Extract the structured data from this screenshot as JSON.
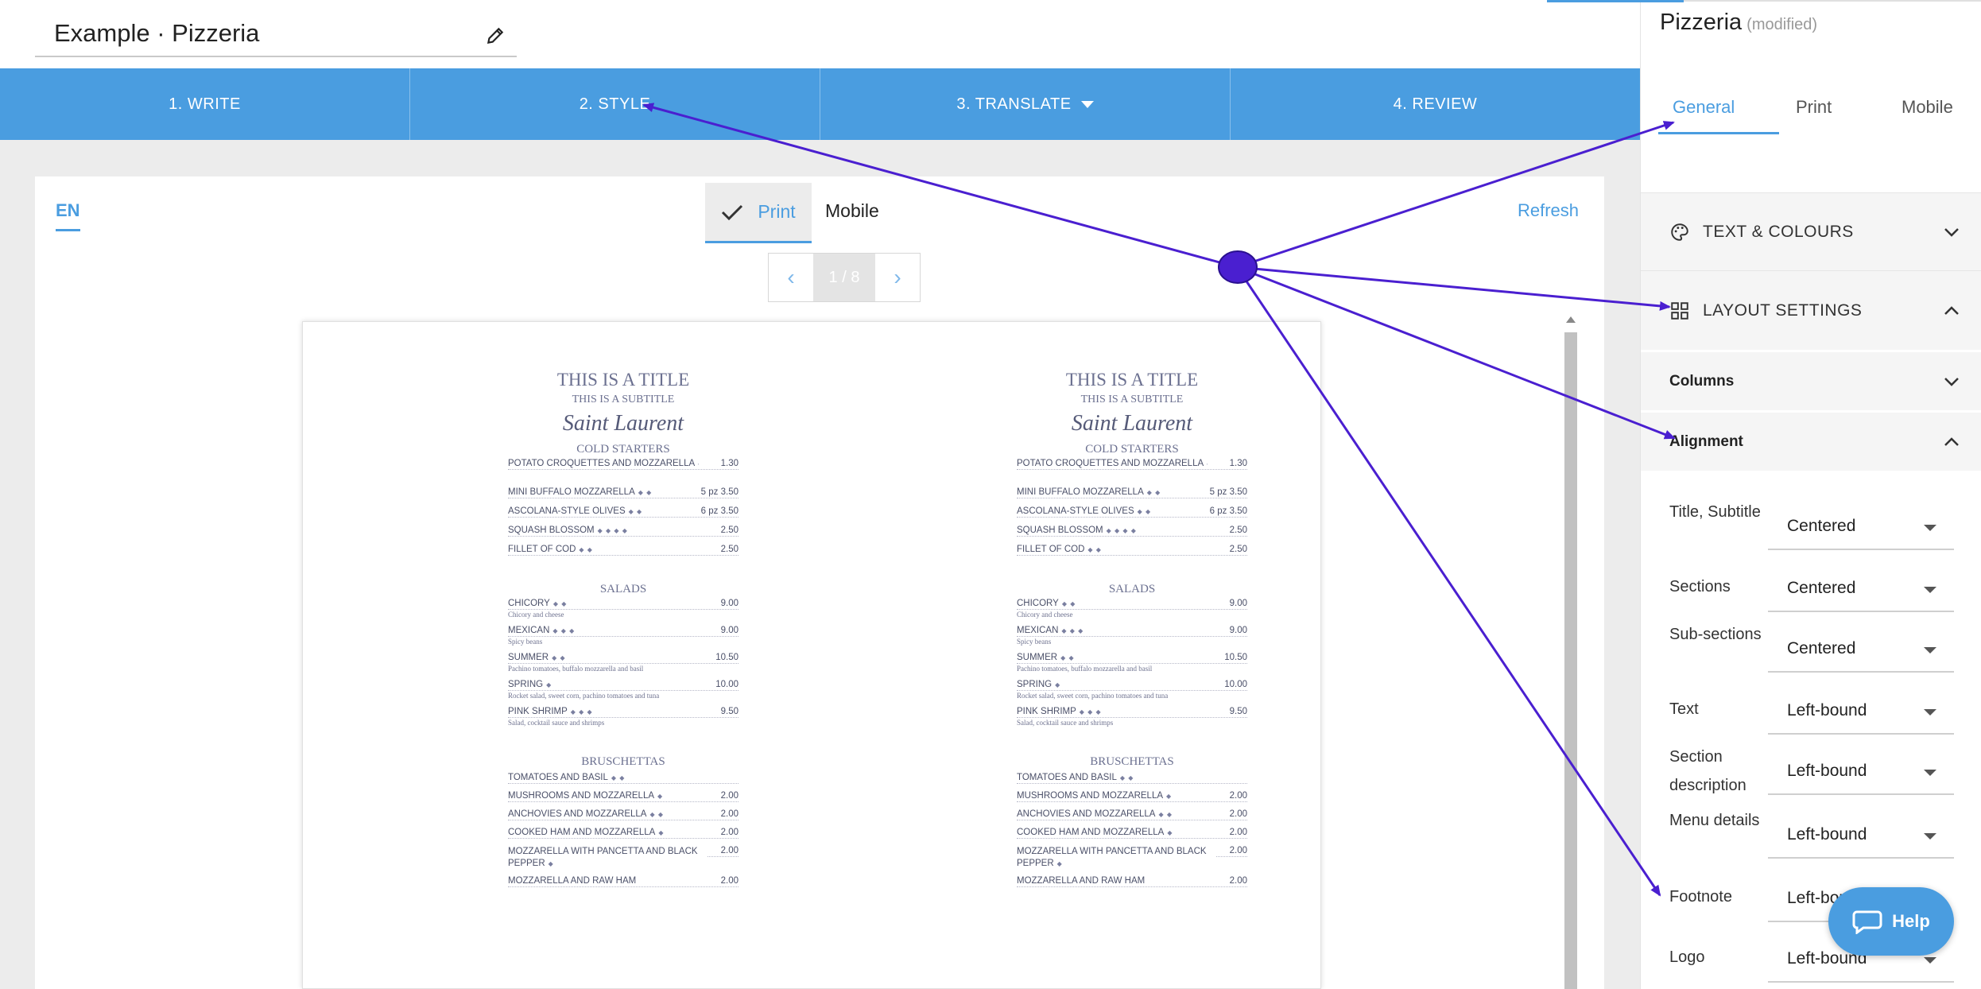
{
  "document": {
    "title": "Example · Pizzeria"
  },
  "steps": [
    {
      "label": "1. WRITE"
    },
    {
      "label": "2. STYLE"
    },
    {
      "label": "3. TRANSLATE"
    },
    {
      "label": "4. REVIEW"
    }
  ],
  "preview": {
    "language": "EN",
    "print_label": "Print",
    "mobile_label": "Mobile",
    "refresh_label": "Refresh",
    "pager": {
      "current": "1 / 8"
    }
  },
  "menu": {
    "title": "THIS IS A TITLE",
    "subtitle": "THIS IS A SUBTITLE",
    "script": "Saint Laurent",
    "sections": [
      {
        "name": "COLD STARTERS",
        "items": [
          {
            "name": "POTATO CROQUETTES AND MOZZARELLA",
            "price": "1.30",
            "icons": "◆ ◆ ▴"
          },
          {
            "name": "MINI BUFFALO MOZZARELLA",
            "price": "5 pz 3.50",
            "icons": "◆ ◆"
          },
          {
            "name": "ASCOLANA-STYLE OLIVES",
            "price": "6 pz 3.50",
            "icons": "◆ ◆"
          },
          {
            "name": "SQUASH BLOSSOM",
            "price": "2.50",
            "icons": "◆ ◆ ◆ ◆"
          },
          {
            "name": "FILLET OF COD",
            "price": "2.50",
            "icons": "◆ ◆"
          }
        ]
      },
      {
        "name": "SALADS",
        "items": [
          {
            "name": "CHICORY",
            "price": "9.00",
            "desc": "Chicory and cheese",
            "icons": "◆ ◆"
          },
          {
            "name": "MEXICAN",
            "price": "9.00",
            "desc": "Spicy beans",
            "icons": "◆ ◆ ◆"
          },
          {
            "name": "SUMMER",
            "price": "10.50",
            "desc": "Pachino tomatoes, buffalo mozzarella and basil",
            "icons": "◆ ◆"
          },
          {
            "name": "SPRING",
            "price": "10.00",
            "desc": "Rocket salad, sweet corn, pachino tomatoes and tuna",
            "icons": "◆"
          },
          {
            "name": "PINK SHRIMP",
            "price": "9.50",
            "desc": "Salad, cocktail sauce and shrimps",
            "icons": "◆ ◆ ◆"
          }
        ]
      },
      {
        "name": "BRUSCHETTAS",
        "items": [
          {
            "name": "TOMATOES AND BASIL",
            "price": "",
            "icons": "◆ ◆"
          },
          {
            "name": "MUSHROOMS AND MOZZARELLA",
            "price": "2.00",
            "icons": "◆"
          },
          {
            "name": "ANCHOVIES AND MOZZARELLA",
            "price": "2.00",
            "icons": "◆ ◆"
          },
          {
            "name": "COOKED HAM AND MOZZARELLA",
            "price": "2.00",
            "icons": "◆"
          },
          {
            "name": "MOZZARELLA WITH PANCETTA AND BLACK PEPPER",
            "price": "2.00",
            "icons": "◆"
          },
          {
            "name": "MOZZARELLA AND RAW HAM",
            "price": "2.00",
            "icons": ""
          }
        ]
      }
    ]
  },
  "panel": {
    "title": "Pizzeria",
    "status": "(modified)",
    "tabs": [
      "General",
      "Print",
      "Mobile"
    ],
    "sections": {
      "text_colours": "TEXT & COLOURS",
      "layout_settings": "LAYOUT SETTINGS",
      "columns": "Columns",
      "alignment": "Alignment"
    },
    "alignment_rows": [
      {
        "label": "Title, Subtitle",
        "value": "Centered"
      },
      {
        "label": "Sections",
        "value": "Centered"
      },
      {
        "label": "Sub-sections",
        "value": "Centered"
      },
      {
        "label": "Text",
        "value": "Left-bound"
      },
      {
        "label": "Section description",
        "value": "Left-bound"
      },
      {
        "label": "Menu details",
        "value": "Left-bound"
      },
      {
        "label": "Footnote",
        "value": "Left-bound"
      },
      {
        "label": "Logo",
        "value": "Left-bound"
      }
    ]
  },
  "help": {
    "label": "Help"
  },
  "colors": {
    "accent": "#4a9de0",
    "annotation": "#4a1fd0"
  }
}
